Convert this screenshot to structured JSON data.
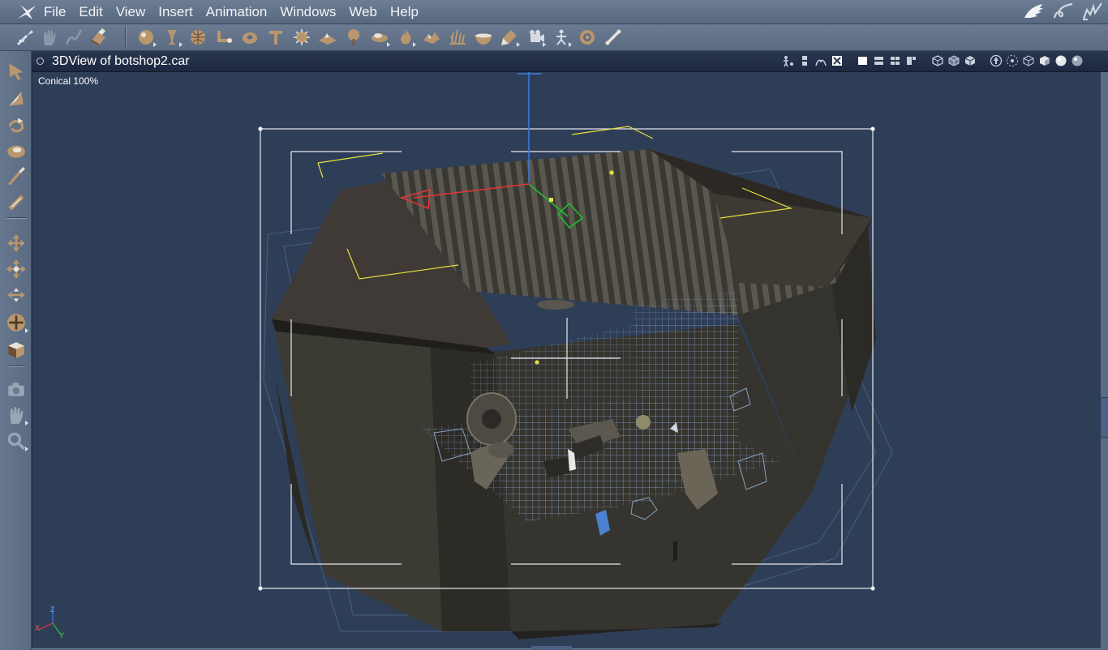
{
  "menu": {
    "items": [
      "File",
      "Edit",
      "View",
      "Insert",
      "Animation",
      "Windows",
      "Web",
      "Help"
    ]
  },
  "menubar_right_icons": [
    "hand-brush-icon",
    "curl-brush-icon",
    "pen-brush-icon"
  ],
  "toolbar": {
    "tools": [
      "brush-icon",
      "hand-icon",
      "tweak-icon",
      "eraser-icon",
      "sphere-icon",
      "lathe-icon",
      "globe-icon",
      "bend-icon",
      "torus-icon",
      "text-icon",
      "spikes-icon",
      "terrain-icon",
      "tree-icon",
      "cloud-icon",
      "fire-icon",
      "rocks-icon",
      "grass-icon",
      "bowl-icon",
      "light-icon",
      "camera-icon",
      "skeleton-icon",
      "target-icon",
      "bone-icon"
    ]
  },
  "left_tools": [
    "select-arrow-icon",
    "rotate-arrow-icon",
    "spin-icon",
    "scale-icon",
    "brush-stick-icon",
    "bone-tool-icon",
    "move-xy-icon",
    "move-4way-icon",
    "move-z-icon",
    "move-all-icon",
    "shading-box-icon",
    "camera-tool-icon",
    "pan-hand-icon",
    "zoom-icon"
  ],
  "view": {
    "title": "3DView of botshop2.car",
    "label": "Conical 100%",
    "controls": [
      "figure-icon",
      "column-icon",
      "hierarchy-icon",
      "nodes-icon",
      "layout-1-icon",
      "layout-2-icon",
      "layout-4-icon",
      "layout-custom-icon",
      "box-wire-icon",
      "box-edge-icon",
      "box-solid-icon",
      "nav-up-icon",
      "nav-orbit-icon",
      "cube-wire-icon",
      "cube-solid-icon",
      "sphere-shaded-icon",
      "sphere-gloss-icon"
    ]
  },
  "axis_labels": {
    "z": "Z",
    "x": "X",
    "y": "Y"
  },
  "colors": {
    "menubar": "#5f7088",
    "viewport": "#2f3e57",
    "selection_frame": "#e8e8f0",
    "x_axis": "#e83434",
    "y_axis": "#22c22e",
    "z_axis": "#3a7be0",
    "guide": "#e6e040"
  }
}
